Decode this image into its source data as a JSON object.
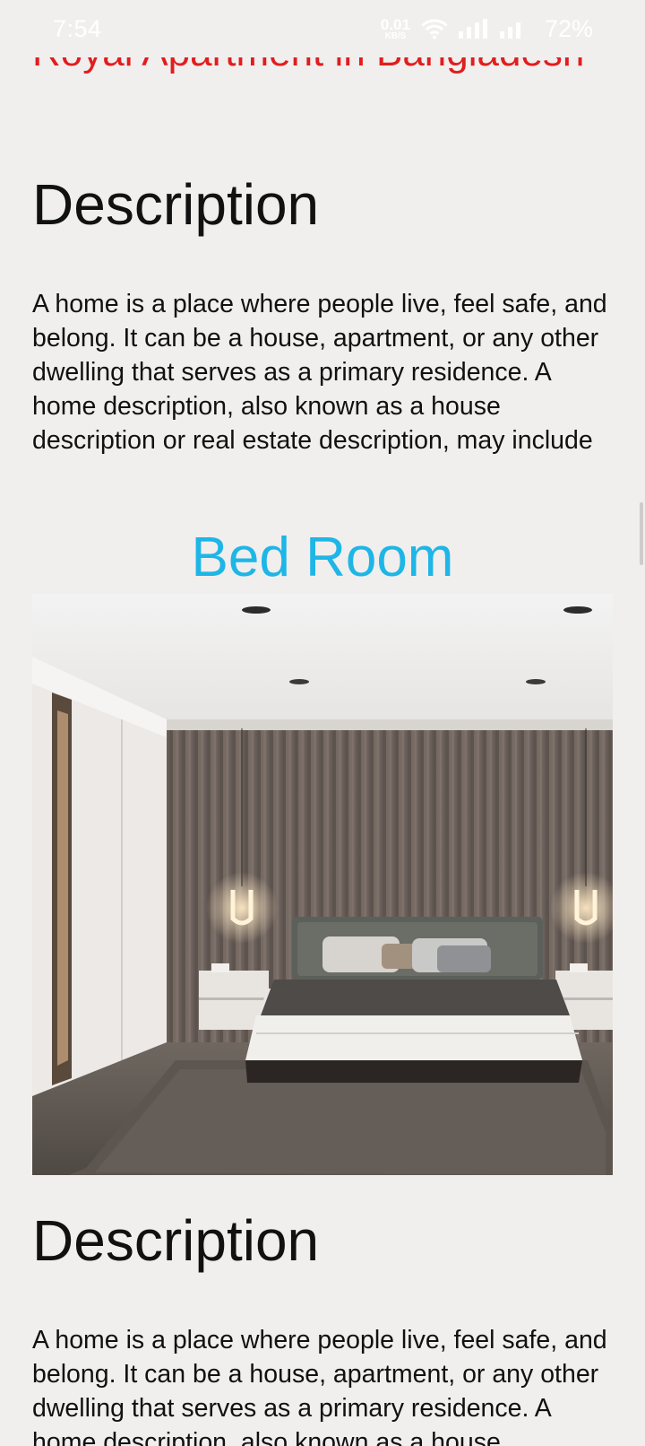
{
  "status_bar": {
    "time": "7:54",
    "net_speed_value": "0.01",
    "net_speed_unit": "KB/S",
    "battery": "72%"
  },
  "page": {
    "title": "Royal Apartment in Bangladesh",
    "description_heading": "Description",
    "description_text": "A home is a place where people live, feel safe, and belong. It can be a house, apartment, or any other dwelling that serves as a primary residence. A home description, also known as a house description or real estate description, may include",
    "bed_room_title": "Bed Room",
    "description_heading_2": "Description",
    "description_text_2": "A home is a place where people live, feel safe, and belong. It can be a house, apartment, or any other dwelling that serves as a primary residence. A home description, also known as a house description or real estate description, may include"
  },
  "colors": {
    "title": "#e11d1d",
    "room_title": "#1eb6e6",
    "background": "#f1eeee"
  }
}
